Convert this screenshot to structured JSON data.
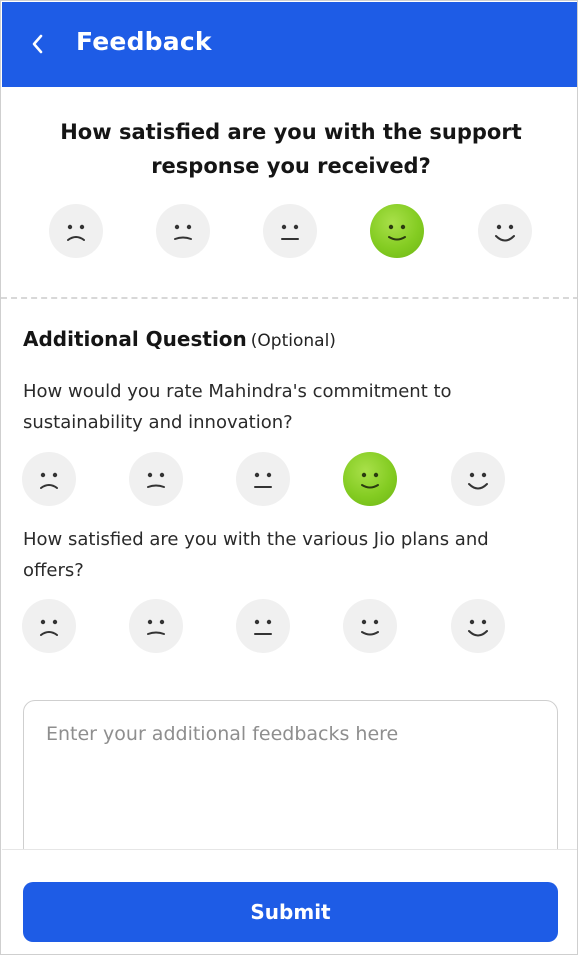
{
  "header": {
    "title": "Feedback",
    "back_icon": "chevron-left-icon",
    "background": "#1e5ce6"
  },
  "main_question": {
    "text": "How satisfied are you with the support response you received?",
    "options": [
      "very-sad-face-icon",
      "sad-face-icon",
      "neutral-face-icon",
      "happy-face-icon",
      "very-happy-face-icon"
    ],
    "selected_index": 3,
    "selected_color": "#84cc22"
  },
  "additional": {
    "title": "Additional Question",
    "optional_label": "(Optional)",
    "questions": [
      {
        "text": "How would you rate Mahindra's commitment to sustainability and innovation?",
        "selected_index": 3
      },
      {
        "text": "How satisfied are you with the various Jio plans and offers?",
        "selected_index": null
      }
    ]
  },
  "feedback_input": {
    "placeholder": "Enter your additional feedbacks here",
    "value": ""
  },
  "submit": {
    "label": "Submit",
    "color": "#1e5ce6"
  }
}
